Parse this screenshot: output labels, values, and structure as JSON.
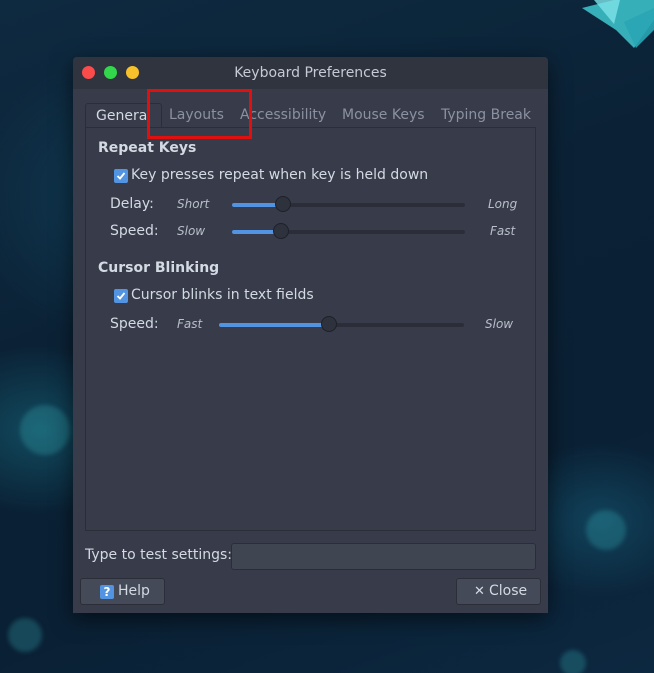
{
  "window": {
    "title": "Keyboard Preferences"
  },
  "tabs": [
    {
      "label": "General",
      "active": true
    },
    {
      "label": "Layouts",
      "active": false
    },
    {
      "label": "Accessibility",
      "active": false
    },
    {
      "label": "Mouse Keys",
      "active": false
    },
    {
      "label": "Typing Break",
      "active": false
    }
  ],
  "repeat_keys": {
    "title": "Repeat Keys",
    "checkbox_label": "Key presses repeat when key is held down",
    "checked": true,
    "delay": {
      "label": "Delay:",
      "min_label": "Short",
      "max_label": "Long",
      "value_fraction": 0.22
    },
    "speed": {
      "label": "Speed:",
      "min_label": "Slow",
      "max_label": "Fast",
      "value_fraction": 0.21
    }
  },
  "cursor_blinking": {
    "title": "Cursor Blinking",
    "checkbox_label": "Cursor blinks in text fields",
    "checked": true,
    "speed": {
      "label": "Speed:",
      "min_label": "Fast",
      "max_label": "Slow",
      "value_fraction": 0.45
    }
  },
  "test": {
    "label": "Type to test settings:",
    "value": "",
    "placeholder": ""
  },
  "buttons": {
    "help_icon": "?",
    "help_label": "Help",
    "close_icon": "✕",
    "close_label": "Close"
  },
  "colors": {
    "accent": "#5294e2",
    "window_bg": "#383c4a",
    "titlebar_bg": "#2f343f",
    "highlight": "#e0100f"
  },
  "icons": {
    "close_window": "red-circle",
    "maximize_window": "green-circle",
    "minimize_window": "yellow-circle",
    "checkbox": "check-icon",
    "help": "help-icon",
    "close": "close-icon"
  }
}
